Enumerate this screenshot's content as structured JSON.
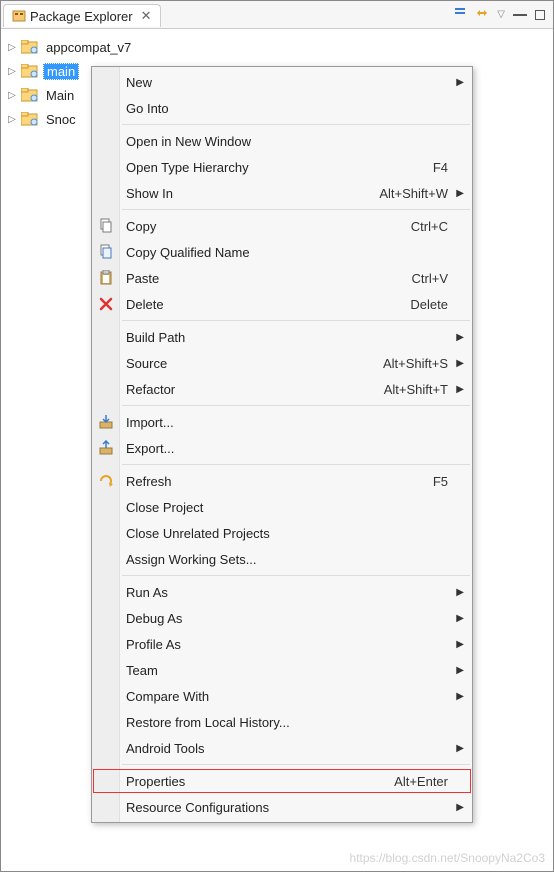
{
  "header": {
    "title": "Package Explorer",
    "close_tooltip": "Close"
  },
  "tree": {
    "items": [
      {
        "label": "appcompat_v7",
        "selected": false
      },
      {
        "label": "main",
        "selected": true
      },
      {
        "label": "Main",
        "selected": false,
        "truncated": "Main"
      },
      {
        "label": "Snoo",
        "selected": false,
        "truncated": "Snoc"
      }
    ]
  },
  "menu": {
    "groups": [
      [
        {
          "label": "New",
          "submenu": true
        },
        {
          "label": "Go Into"
        }
      ],
      [
        {
          "label": "Open in New Window"
        },
        {
          "label": "Open Type Hierarchy",
          "shortcut": "F4"
        },
        {
          "label": "Show In",
          "shortcut": "Alt+Shift+W",
          "submenu": true
        }
      ],
      [
        {
          "label": "Copy",
          "shortcut": "Ctrl+C",
          "icon": "copy"
        },
        {
          "label": "Copy Qualified Name",
          "icon": "copy-qualified"
        },
        {
          "label": "Paste",
          "shortcut": "Ctrl+V",
          "icon": "paste"
        },
        {
          "label": "Delete",
          "shortcut": "Delete",
          "icon": "delete"
        }
      ],
      [
        {
          "label": "Build Path",
          "submenu": true
        },
        {
          "label": "Source",
          "shortcut": "Alt+Shift+S",
          "submenu": true
        },
        {
          "label": "Refactor",
          "shortcut": "Alt+Shift+T",
          "submenu": true
        }
      ],
      [
        {
          "label": "Import...",
          "icon": "import"
        },
        {
          "label": "Export...",
          "icon": "export"
        }
      ],
      [
        {
          "label": "Refresh",
          "shortcut": "F5",
          "icon": "refresh"
        },
        {
          "label": "Close Project"
        },
        {
          "label": "Close Unrelated Projects"
        },
        {
          "label": "Assign Working Sets..."
        }
      ],
      [
        {
          "label": "Run As",
          "submenu": true
        },
        {
          "label": "Debug As",
          "submenu": true
        },
        {
          "label": "Profile As",
          "submenu": true
        },
        {
          "label": "Team",
          "submenu": true
        },
        {
          "label": "Compare With",
          "submenu": true
        },
        {
          "label": "Restore from Local History..."
        },
        {
          "label": "Android Tools",
          "submenu": true
        }
      ],
      [
        {
          "label": "Properties",
          "shortcut": "Alt+Enter",
          "highlight": true
        },
        {
          "label": "Resource Configurations",
          "submenu": true
        }
      ]
    ]
  },
  "watermark": "https://blog.csdn.net/SnoopyNa2Co3"
}
